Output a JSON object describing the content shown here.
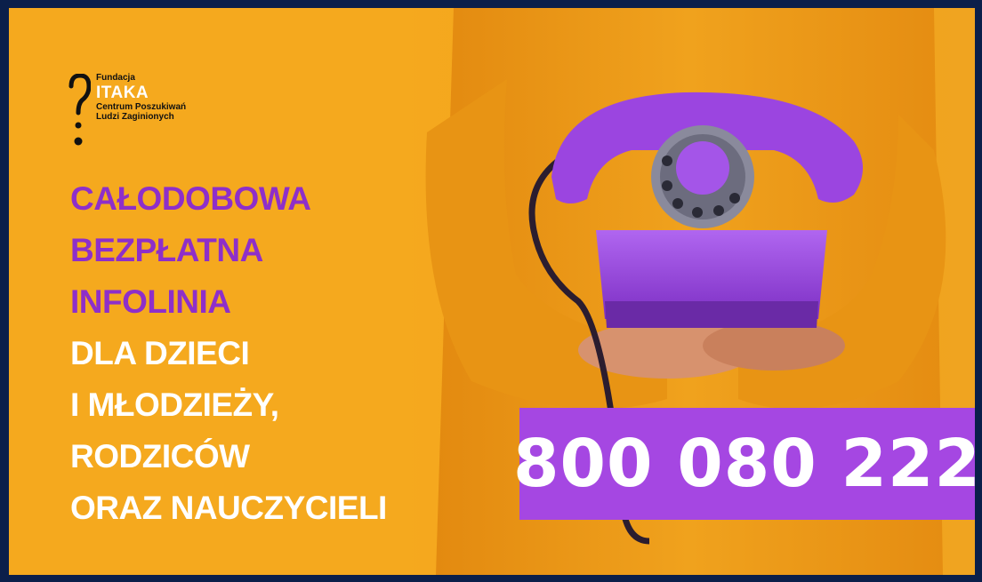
{
  "logo": {
    "line1": "Fundacja",
    "name": "ITAKA",
    "line2": "Centrum Poszukiwań",
    "line3": "Ludzi Zaginionych"
  },
  "headline": {
    "purple_lines": [
      "CAŁODOBOWA",
      "BEZPŁATNA",
      "INFOLINIA"
    ],
    "white_lines": [
      "DLA DZIECI",
      "I MŁODZIEŻY,",
      "RODZICÓW",
      "ORAZ NAUCZYCIELI"
    ]
  },
  "phone_number": "800 080 222",
  "colors": {
    "background": "#f5a91e",
    "purple_text": "#8e2fc9",
    "number_box": "#a547e2",
    "frame": "#0b1f4a"
  },
  "icons": [
    "itaka-logo-icon",
    "rotary-telephone-icon"
  ]
}
